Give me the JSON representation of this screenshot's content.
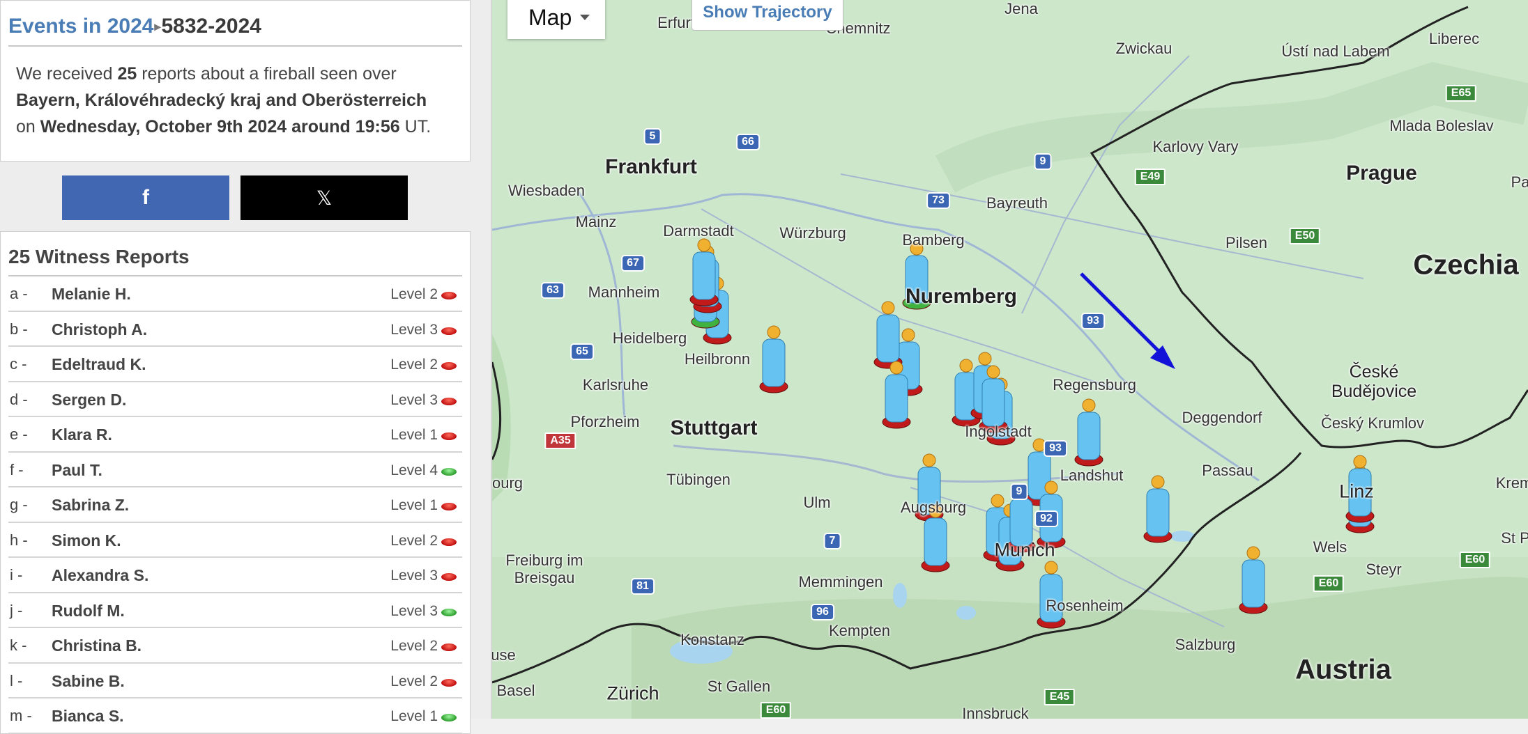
{
  "header": {
    "breadcrumb_link": "Events in 2024",
    "breadcrumb_separator": "▸",
    "event_id": "5832-2024"
  },
  "description": {
    "prefix": "We received",
    "count": "25",
    "mid": "reports about a fireball seen over",
    "regions": "Bayern, Královéhradecký kraj and Oberösterreich",
    "on": "on",
    "date_time": "Wednesday, October 9th 2024 around 19:56",
    "tz": "UT."
  },
  "share": {
    "facebook_icon": "f",
    "x_icon": "𝕏"
  },
  "reports": {
    "title": "25 Witness Reports",
    "items": [
      {
        "letter": "a -",
        "name": "Melanie H.",
        "level": "Level 2",
        "status": "red"
      },
      {
        "letter": "b -",
        "name": "Christoph A.",
        "level": "Level 3",
        "status": "red"
      },
      {
        "letter": "c -",
        "name": "Edeltraud K.",
        "level": "Level 2",
        "status": "red"
      },
      {
        "letter": "d -",
        "name": "Sergen D.",
        "level": "Level 3",
        "status": "red"
      },
      {
        "letter": "e -",
        "name": "Klara R.",
        "level": "Level 1",
        "status": "red"
      },
      {
        "letter": "f -",
        "name": "Paul T.",
        "level": "Level 4",
        "status": "green"
      },
      {
        "letter": "g -",
        "name": "Sabrina Z.",
        "level": "Level 1",
        "status": "red"
      },
      {
        "letter": "h -",
        "name": "Simon K.",
        "level": "Level 2",
        "status": "red"
      },
      {
        "letter": "i -",
        "name": "Alexandra S.",
        "level": "Level 3",
        "status": "red"
      },
      {
        "letter": "j -",
        "name": "Rudolf M.",
        "level": "Level 3",
        "status": "green"
      },
      {
        "letter": "k -",
        "name": "Christina B.",
        "level": "Level 2",
        "status": "red"
      },
      {
        "letter": "l -",
        "name": "Sabine  B.",
        "level": "Level 2",
        "status": "red"
      },
      {
        "letter": "m -",
        "name": "Bianca S.",
        "level": "Level 1",
        "status": "green"
      }
    ]
  },
  "map": {
    "type_label": "Map",
    "trajectory_button": "Show Trajectory",
    "colors": {
      "water": "#a8d4f0",
      "land": "#cde7cb",
      "border": "#222222",
      "trajectory": "#1212d8",
      "witness": "#66c2f0"
    },
    "countries": [
      "Czechia",
      "Austria"
    ],
    "big_cities": [
      "Frankfurt",
      "Stuttgart",
      "Prague",
      "Nuremberg"
    ],
    "cities": [
      "Erfurt",
      "Jena",
      "Chemnitz",
      "Ústí nad Labem",
      "Liberec",
      "Zwickau",
      "Mlada Boleslav",
      "Karlovy Vary",
      "Wiesbaden",
      "Mainz",
      "Darmstadt",
      "Würzburg",
      "Bamberg",
      "Bayreuth",
      "Pilsen",
      "Mannheim",
      "Heidelberg",
      "Heilbronn",
      "Karlsruhe",
      "Pforzheim",
      "Regensburg",
      "Deggendorf",
      "České Budějovice",
      "Český Krumlov",
      "Ingolstadt",
      "Landshut",
      "Passau",
      "Tübingen",
      "Augsburg",
      "Ulm",
      "Munich",
      "Linz",
      "Wels",
      "Steyr",
      "Freiburg im Breisgau",
      "Memmingen",
      "Kempten",
      "Rosenheim",
      "Salzburg",
      "Konstanz",
      "Basel",
      "Zürich",
      "St Gallen",
      "Innsbruck",
      "Pa",
      "Krem",
      "St P",
      "ourg",
      "use"
    ],
    "routes": [
      "5",
      "66",
      "9",
      "73",
      "67",
      "63",
      "65",
      "93",
      "93",
      "9",
      "92",
      "7",
      "81",
      "96",
      "A35",
      "E49",
      "E50",
      "E65",
      "E60",
      "E60",
      "E45",
      "E60"
    ]
  }
}
